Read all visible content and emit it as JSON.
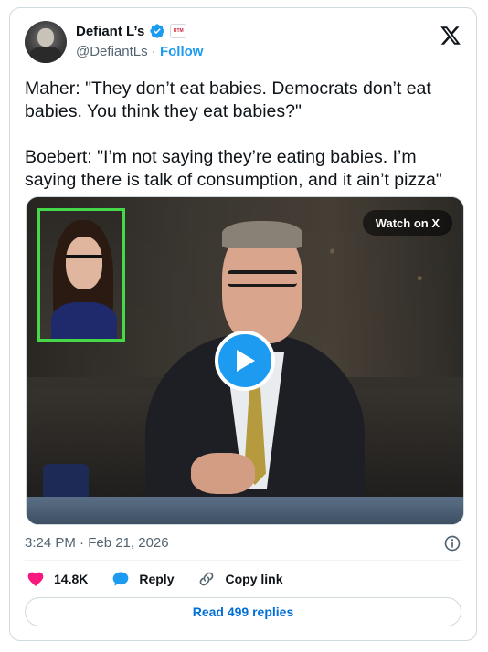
{
  "author": {
    "name": "Defiant L’s",
    "handle": "@DefiantLs",
    "separator": " · ",
    "follow_label": "Follow",
    "verified": true,
    "affiliate_badge_text": "RTM"
  },
  "tweet": {
    "text": "Maher: \"They don’t eat babies. Democrats don’t eat babies. You think they eat babies?\"\n\nBoebert: \"I’m not saying they’re eating babies. I’m saying there is talk of consumption, and it ain’t pizza\"",
    "timestamp": "3:24 PM · Feb 21, 2026"
  },
  "media": {
    "watch_label": "Watch on X"
  },
  "actions": {
    "likes": "14.8K",
    "reply_label": "Reply",
    "copy_link_label": "Copy link"
  },
  "footer": {
    "read_replies_label": "Read 499 replies"
  },
  "colors": {
    "accent": "#1d9bf0",
    "like_heart": "#f91880",
    "text": "#0f1419",
    "muted": "#536471",
    "inset_border": "#45d94a"
  }
}
